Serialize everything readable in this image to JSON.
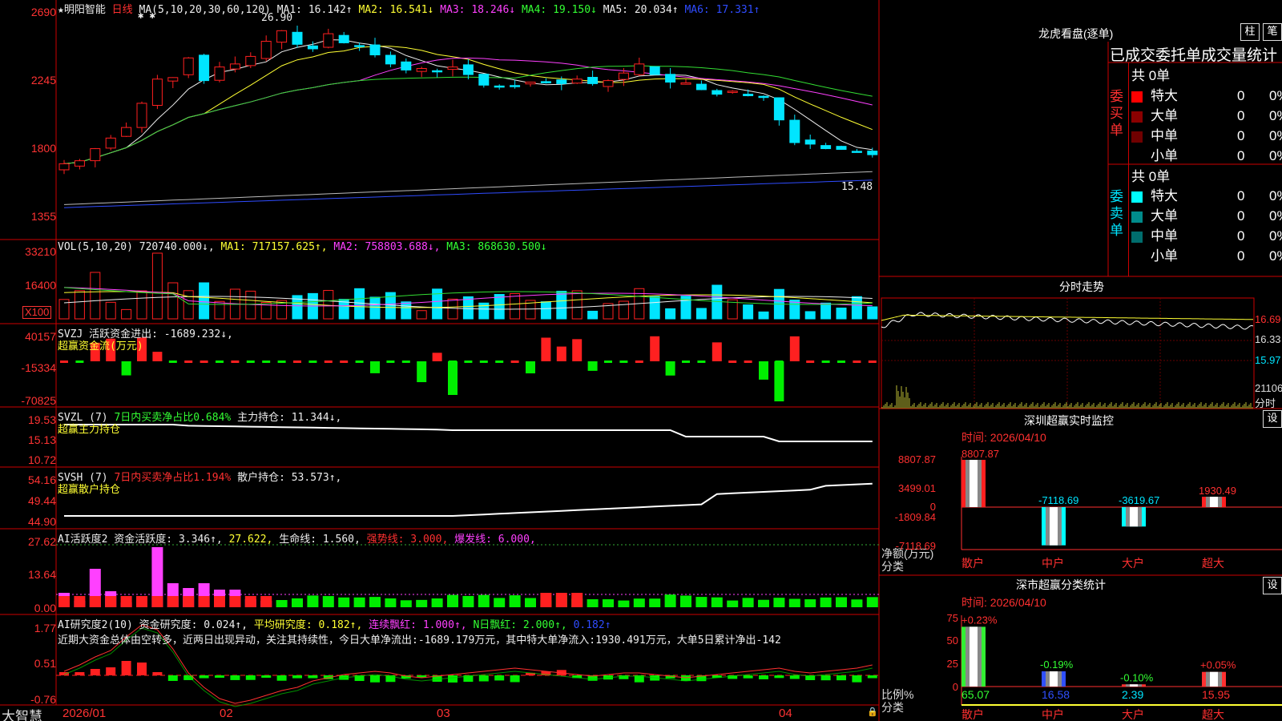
{
  "stock": {
    "name": "★明阳智能",
    "period": "日线",
    "ma_header": "MA(5,10,20,30,60,120)",
    "ma1": "MA1: 16.142↑",
    "ma2": "MA2: 16.541↓",
    "ma3": "MA3: 18.246↓",
    "ma4": "MA4: 19.150↓",
    "ma5": "MA5: 20.034↑",
    "ma6": "MA6: 17.331↑",
    "high_mark": "26.90",
    "low_mark": "15.48",
    "y_ticks": [
      "2690",
      "2245",
      "1800",
      "1355"
    ]
  },
  "vol": {
    "header": "VOL(5,10,20)",
    "value": "720740.000↓,",
    "ma1": "MA1: 717157.625↑,",
    "ma2": "MA2: 758803.688↓,",
    "ma3": "MA3: 868630.500↓",
    "y_ticks": [
      "33210",
      "16400"
    ],
    "unit": "X100"
  },
  "svzj": {
    "header": "SVZJ  活跃资金进出: -1689.232↓,",
    "sub": "超赢资金流(万元)",
    "y_ticks": [
      "40157",
      "-15334",
      "-70825"
    ]
  },
  "svzl": {
    "header": "SVZL (7)",
    "mid": "7日内买卖净占比0.684%",
    "val": "主力持仓: 11.344↓,",
    "sub": "超赢主力持仓",
    "y_ticks": [
      "19.53",
      "15.13",
      "10.72"
    ]
  },
  "svsh": {
    "header": "SVSH (7)",
    "mid": "7日内买卖净占比1.194%",
    "val": "散户持仓: 53.573↑,",
    "sub": "超赢散户持仓",
    "y_ticks": [
      "54.16",
      "49.44",
      "44.90"
    ]
  },
  "ai1": {
    "header": "AI活跃度2 资金活跃度: 3.346↑,",
    "v2": "27.622,",
    "v3": "生命线: 1.560,",
    "v4": "强势线: 3.000,",
    "v5": "爆发线: 6.000,",
    "y_ticks": [
      "27.62",
      "13.64",
      "0.00"
    ]
  },
  "ai2": {
    "header": "AI研究度2(10) 资金研究度: 0.024↑,",
    "v2": "平均研究度: 0.182↑,",
    "v3": "连续飘红: 1.000↑,",
    "v4": "N日飘红: 2.000↑,",
    "v5": "0.182↑",
    "comment": "近期大资金总体由空转多，近两日出现异动，关注其持续性，今日大单净流出:-1689.179万元，其中特大单净流入:1930.491万元，大单5日累计净出-142",
    "y_ticks": [
      "1.77",
      "0.51",
      "-0.76"
    ]
  },
  "footer": {
    "brand": "大智慧",
    "dates": [
      "2026/01",
      "02",
      "03",
      "04"
    ]
  },
  "right": {
    "lhb_title": "龙虎看盘(逐单)",
    "btn1": "柱",
    "btn2": "笔",
    "stats_title": "已成交委托单成交量统计",
    "buy_label": "委买单",
    "sell_label": "委卖单",
    "buy_total": "共 0单",
    "sell_total": "共 0单",
    "buy_rows": [
      {
        "name": "特大",
        "n": "0",
        "p": "0%",
        "color": "#ff0000"
      },
      {
        "name": "大单",
        "n": "0",
        "p": "0%",
        "color": "#8b0000"
      },
      {
        "name": "中单",
        "n": "0",
        "p": "0%",
        "color": "#700000"
      },
      {
        "name": "小单",
        "n": "0",
        "p": "0%",
        "color": "#000000"
      }
    ],
    "sell_rows": [
      {
        "name": "特大",
        "n": "0",
        "p": "0%",
        "color": "#00ffff"
      },
      {
        "name": "大单",
        "n": "0",
        "p": "0%",
        "color": "#008b8b"
      },
      {
        "name": "中单",
        "n": "0",
        "p": "0%",
        "color": "#006d6d"
      },
      {
        "name": "小单",
        "n": "0",
        "p": "0%",
        "color": "#000000"
      }
    ],
    "intraday_title": "分时走势",
    "intraday_ticks": [
      "16.69",
      "16.33",
      "15.97",
      "21106",
      "分时"
    ],
    "sz_title": "深圳超赢实时监控",
    "sz_set": "设",
    "sz_time": "时间: 2026/04/10",
    "sz_y": [
      "8807.87",
      "3499.01",
      "0",
      "-1809.84",
      "-7118.69"
    ],
    "sz_unit": "净额(万元)",
    "sz_unit2": "分类",
    "sz_bars": [
      {
        "cat": "散户",
        "label": "8807.87",
        "value": 8807.87
      },
      {
        "cat": "中户",
        "label": "-7118.69",
        "value": -7118.69
      },
      {
        "cat": "大户",
        "label": "-3619.67",
        "value": -3619.67
      },
      {
        "cat": "超大",
        "label": "1930.49",
        "value": 1930.49
      }
    ],
    "cls_title": "深市超赢分类统计",
    "cls_set": "设",
    "cls_time": "时间: 2026/04/10",
    "cls_y": [
      "75",
      "50",
      "25",
      "0"
    ],
    "cls_unit": "比例%",
    "cls_unit2": "分类",
    "cls_bars": [
      {
        "cat": "散户",
        "pct": "65.07",
        "chg": "+0.23%",
        "value": 65.07,
        "color": "#ff3030"
      },
      {
        "cat": "中户",
        "pct": "16.58",
        "chg": "-0.19%",
        "value": 16.58,
        "color": "#3050ff"
      },
      {
        "cat": "大户",
        "pct": "2.39",
        "chg": "-0.10%",
        "value": 2.39,
        "color": "#ff3030"
      },
      {
        "cat": "超大",
        "pct": "15.95",
        "chg": "+0.05%",
        "value": 15.95,
        "color": "#ff3030"
      }
    ]
  },
  "chart_data": {
    "type": "bar",
    "title": "深圳超赢实时监控",
    "categories": [
      "散户",
      "中户",
      "大户",
      "超大"
    ],
    "values": [
      8807.87,
      -7118.69,
      -3619.67,
      1930.49
    ],
    "ylabel": "净额(万元)",
    "ylim": [
      -7118.69,
      8807.87
    ]
  }
}
